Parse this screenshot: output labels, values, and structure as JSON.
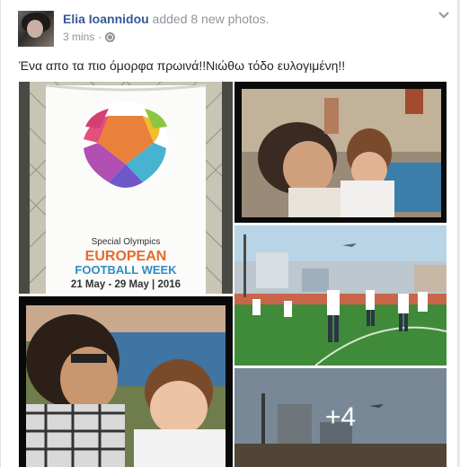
{
  "post": {
    "author": "Elia Ioannidou",
    "action": " added 8 new photos.",
    "time": "3 mins",
    "separator": "·",
    "status": "Ένα απο τα πιο όμορφα πρωινά!!Νιώθω τόδο ευλογιμένη!!",
    "more_photos": "+4"
  },
  "banner": {
    "line1": "Special Olympics",
    "line2": "EUROPEAN",
    "line3": "FOOTBALL WEEK",
    "line4": "21 May - 29 May | 2016"
  },
  "colors": {
    "link": "#365899",
    "meta": "#90949c",
    "text": "#1d2129"
  }
}
